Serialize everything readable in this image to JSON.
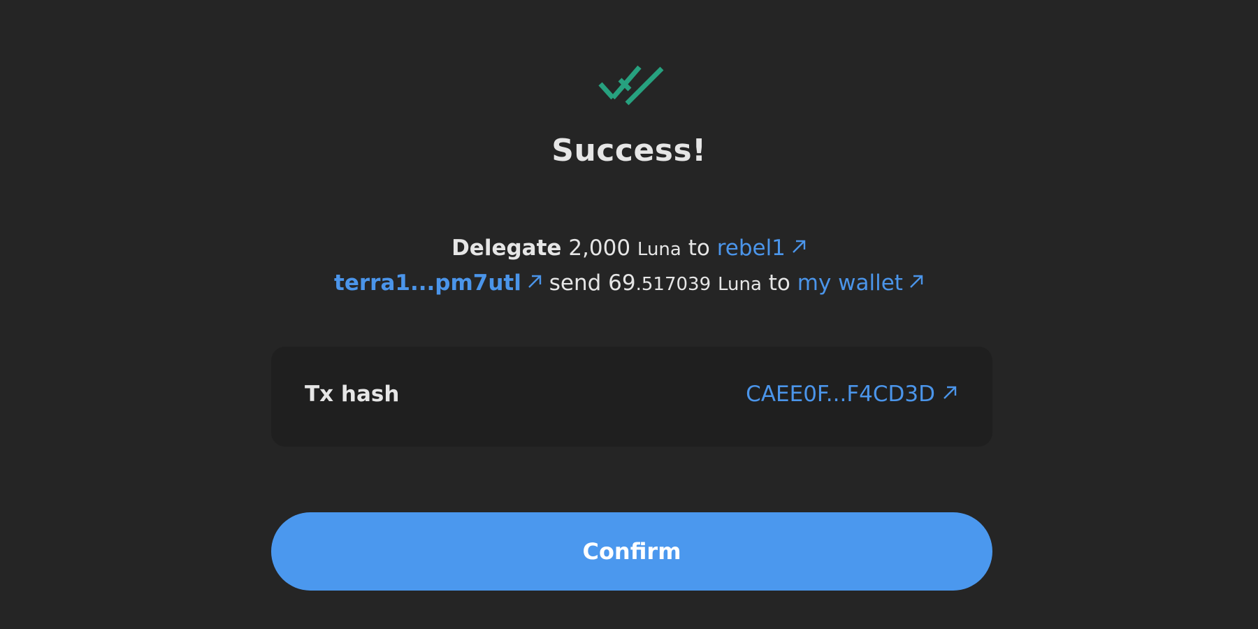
{
  "status": {
    "title": "Success!",
    "icon": "double-check-icon",
    "icon_color": "#27a17f"
  },
  "message": {
    "line1": {
      "action": "Delegate",
      "amount": "2,000",
      "denom": "Luna",
      "connector": "to",
      "validator_link": "rebel1"
    },
    "line2": {
      "sender_link": "terra1...pm7utl",
      "verb": "send",
      "amount_int": "69",
      "amount_dec": ".517039",
      "denom": "Luna",
      "connector": "to",
      "recipient_link": "my wallet"
    }
  },
  "tx": {
    "label": "Tx hash",
    "hash_link": "CAEE0F...F4CD3D"
  },
  "confirm_button": {
    "label": "Confirm"
  },
  "colors": {
    "background": "#252525",
    "card": "#1f1f1f",
    "link": "#4b95ea",
    "button": "#4b98ee"
  }
}
